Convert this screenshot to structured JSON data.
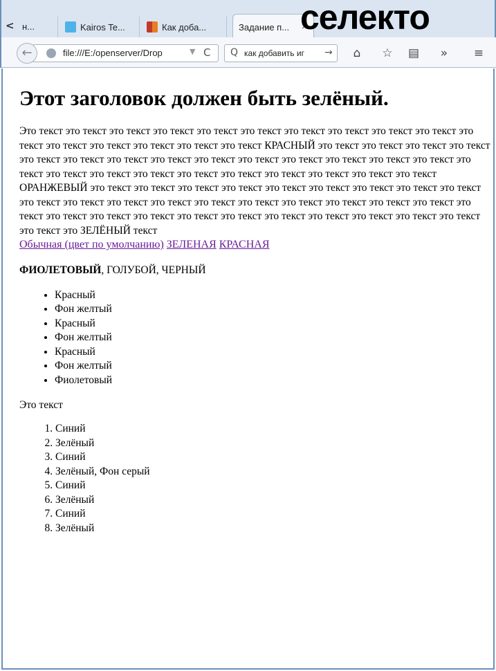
{
  "browser": {
    "tabs": [
      {
        "label": "н...",
        "icon": "page-icon"
      },
      {
        "label": "Kairos Te...",
        "icon": "kairos-icon",
        "icon_color": "#4fb3e8"
      },
      {
        "label": "Как доба...",
        "icon": "blocks-icon",
        "icon_color": "#c0392b"
      },
      {
        "label": "Задание п...",
        "icon": "none",
        "active": true
      }
    ],
    "tab_close_glyph": "×",
    "overlay_text": "селекто",
    "url": "file:///E:/openserver/Drop",
    "search_value": "как добавить иг",
    "back_glyph": "←",
    "reload_glyph": "C",
    "dropdown_glyph": "▼",
    "search_glyph": "Q",
    "go_glyph": "→",
    "home_glyph": "⌂",
    "star_glyph": "☆",
    "reader_glyph": "▤",
    "overflow_glyph": "»",
    "menu_glyph": "≡"
  },
  "page": {
    "heading": "Этот заголовок должен быть зелёный.",
    "paragraph": "Это текст это текст это текст это текст это текст это текст это текст это текст это текст это текст это текст это текст это текст это текст это текст это текст КРАСНЫЙ это текст это текст это текст это текст это текст это текст это текст это текст это текст это текст это текст это текст это текст это текст это текст это текст это текст это текст это текст это текст это текст это текст это текст это текст ОРАНЖЕВЫЙ это текст это текст это текст это текст это текст это текст это текст это текст это текст это текст это текст это текст это текст это текст это текст это текст это текст это текст это текст это текст это текст это текст это текст это текст это текст это текст это текст это текст это текст это текст это текст это ЗЕЛЁНЫЙ текст",
    "links": [
      "Обычная (цвет по умолчанию)",
      "ЗЕЛЕНАЯ",
      "КРАСНАЯ"
    ],
    "colors_bold": "ФИОЛЕТОВЫЙ",
    "colors_rest": ", ГОЛУБОЙ, ЧЕРНЫЙ",
    "bullets": [
      "Красный",
      "Фон желтый",
      "Красный",
      "Фон желтый",
      "Красный",
      "Фон желтый",
      "Фиолетовый"
    ],
    "plain_text": "Это текст",
    "numbered": [
      "Синий",
      "Зелёный",
      "Синий",
      "Зелёный, Фон серый",
      "Синий",
      "Зелёный",
      "Синий",
      "Зелёный"
    ]
  },
  "colors": {
    "link_visited": "#6a1b9a",
    "frame_border": "#6b8fb8"
  }
}
